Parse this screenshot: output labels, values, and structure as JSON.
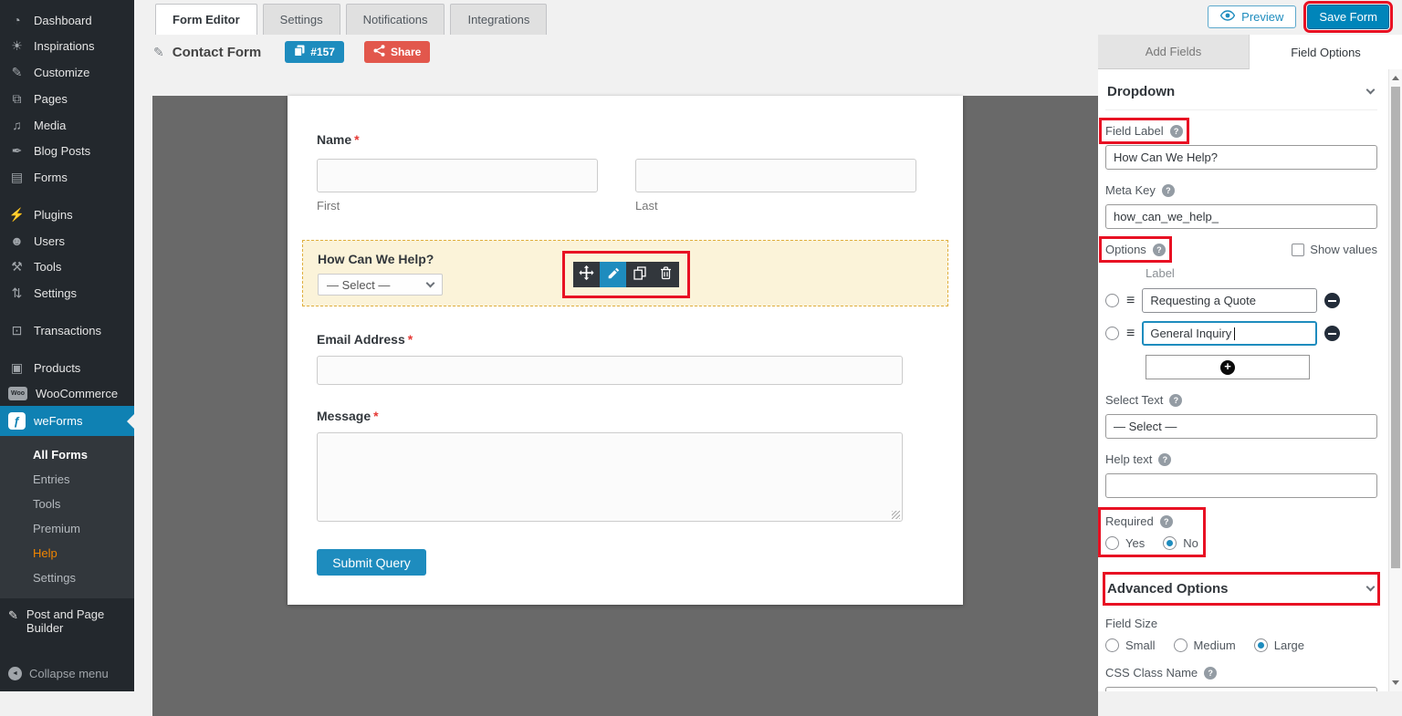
{
  "topbar": {
    "tabs": [
      {
        "label": "Form Editor"
      },
      {
        "label": "Settings"
      },
      {
        "label": "Notifications"
      },
      {
        "label": "Integrations"
      }
    ],
    "preview_label": "Preview",
    "save_label": "Save Form"
  },
  "form_header": {
    "title": "Contact Form",
    "id_badge": "#157",
    "share_label": "Share"
  },
  "sidebar": {
    "items": [
      {
        "icon": "dashboard-icon",
        "glyph": "◔",
        "label": "Dashboard"
      },
      {
        "icon": "inspirations-icon",
        "glyph": "☀",
        "label": "Inspirations"
      },
      {
        "icon": "customize-icon",
        "glyph": "✎",
        "label": "Customize"
      },
      {
        "icon": "pages-icon",
        "glyph": "⧉",
        "label": "Pages"
      },
      {
        "icon": "media-icon",
        "glyph": "♫",
        "label": "Media"
      },
      {
        "icon": "blog-posts-icon",
        "glyph": "✒",
        "label": "Blog Posts"
      },
      {
        "icon": "forms-icon",
        "glyph": "▤",
        "label": "Forms"
      },
      {
        "icon": "plugins-icon",
        "glyph": "⚡",
        "label": "Plugins"
      },
      {
        "icon": "users-icon",
        "glyph": "☻",
        "label": "Users"
      },
      {
        "icon": "tools-icon",
        "glyph": "⚒",
        "label": "Tools"
      },
      {
        "icon": "settings-icon",
        "glyph": "⇅",
        "label": "Settings"
      },
      {
        "icon": "transactions-icon",
        "glyph": "⊡",
        "label": "Transactions"
      },
      {
        "icon": "products-icon",
        "glyph": "▣",
        "label": "Products"
      },
      {
        "icon": "woocommerce-icon",
        "glyph": "Woo",
        "label": "WooCommerce"
      },
      {
        "icon": "weforms-icon",
        "glyph": "ƒ",
        "label": "weForms"
      }
    ],
    "submenu": [
      {
        "label": "All Forms"
      },
      {
        "label": "Entries"
      },
      {
        "label": "Tools"
      },
      {
        "label": "Premium"
      },
      {
        "label": "Help"
      },
      {
        "label": "Settings"
      }
    ],
    "post_builder_label": "Post and Page Builder",
    "post_builder_glyph": "✎",
    "collapse_label": "Collapse menu",
    "collapse_glyph": "◄"
  },
  "canvas": {
    "required_mark": "*",
    "name_field": {
      "label": "Name",
      "first_sublabel": "First",
      "last_sublabel": "Last"
    },
    "dropdown_field": {
      "label": "How Can We Help?",
      "select_placeholder": "— Select —"
    },
    "email_field": {
      "label": "Email Address"
    },
    "message_field": {
      "label": "Message"
    },
    "submit_label": "Submit Query"
  },
  "panel": {
    "tab_add_fields": "Add Fields",
    "tab_field_options": "Field Options",
    "section_title": "Dropdown",
    "help_glyph": "?",
    "field_label": {
      "label": "Field Label",
      "value": "How Can We Help?"
    },
    "meta_key": {
      "label": "Meta Key",
      "value": "how_can_we_help_"
    },
    "options": {
      "label": "Options",
      "show_values_label": "Show values",
      "column_header": "Label",
      "drag_glyph": "≡",
      "rows": [
        {
          "value": "Requesting a Quote"
        },
        {
          "value": "General Inquiry"
        }
      ]
    },
    "select_text": {
      "label": "Select Text",
      "value": "— Select —"
    },
    "help_text": {
      "label": "Help text",
      "value": ""
    },
    "required": {
      "label": "Required",
      "yes_label": "Yes",
      "no_label": "No",
      "selected": "No"
    },
    "advanced": {
      "title": "Advanced Options"
    },
    "field_size": {
      "label": "Field Size",
      "options": [
        {
          "label": "Small"
        },
        {
          "label": "Medium"
        },
        {
          "label": "Large"
        }
      ],
      "selected": "Large"
    },
    "css_class": {
      "label": "CSS Class Name",
      "value": ""
    }
  },
  "colors": {
    "save_button_blue": "#0085ba",
    "badge_blue": "#1e8cbe",
    "share_red": "#e2574c",
    "annotation_red": "#e81123",
    "sidebar_active_blue": "#0f81b3",
    "help_orange": "#f18500",
    "highlight_bg": "#fbf3d9",
    "canvas_gray": "#696969"
  }
}
